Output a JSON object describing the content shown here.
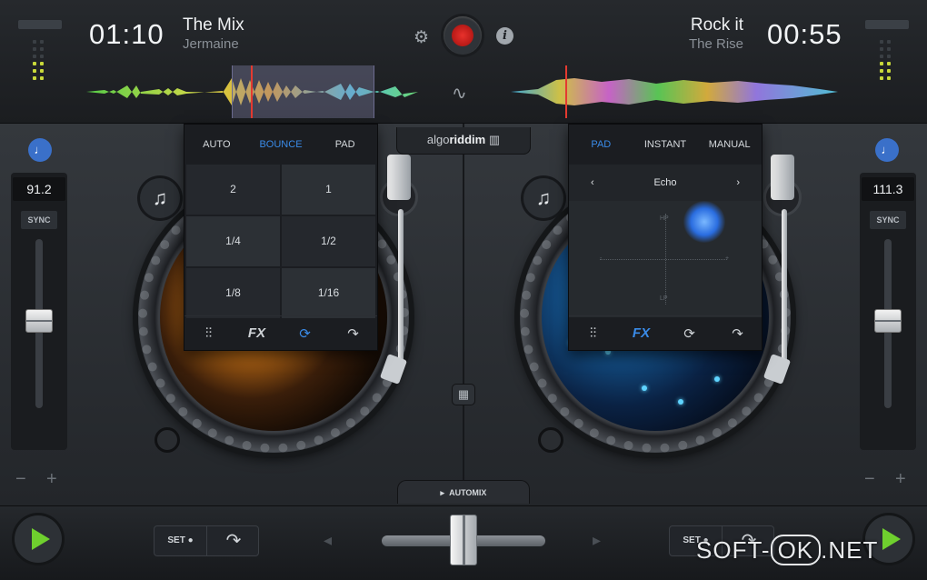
{
  "left_deck": {
    "time": "01:10",
    "title": "The Mix",
    "artist": "Jermaine",
    "bpm": "91.2",
    "sync_label": "SYNC",
    "loop_tabs": [
      "AUTO",
      "BOUNCE",
      "PAD"
    ],
    "active_loop_tab": "BOUNCE",
    "loop_values": [
      "2",
      "1",
      "1/4",
      "1/2",
      "1/8",
      "1/16"
    ],
    "tools": [
      "mixer-icon",
      "FX",
      "loop-icon",
      "jump-icon"
    ],
    "fx_label": "FX",
    "set_label": "SET",
    "pitch_level": 0.48
  },
  "right_deck": {
    "time": "00:55",
    "title": "Rock it",
    "artist": "The Rise",
    "bpm": "111.3",
    "sync_label": "SYNC",
    "fx_tabs": [
      "PAD",
      "INSTANT",
      "MANUAL"
    ],
    "active_fx_tab": "PAD",
    "effect_name": "Echo",
    "pad_labels": {
      "top": "HP",
      "bottom": "LP",
      "left": "-",
      "right": "+"
    },
    "fx_label": "FX",
    "set_label": "SET",
    "pitch_level": 0.48
  },
  "center": {
    "logo_prefix": "algo",
    "logo_brand": "riddim",
    "automix_label": "AUTOMIX",
    "crossfader_level": 0.5
  },
  "controls": {
    "minus_label": "−",
    "plus_label": "+"
  },
  "watermark": {
    "prefix": "SOFT-",
    "boxed": "OK",
    "suffix": ".NET"
  },
  "colors": {
    "accent": "#3a8be8",
    "record": "#e8312c",
    "play": "#6fd02e",
    "meter": "#c8d83a"
  }
}
